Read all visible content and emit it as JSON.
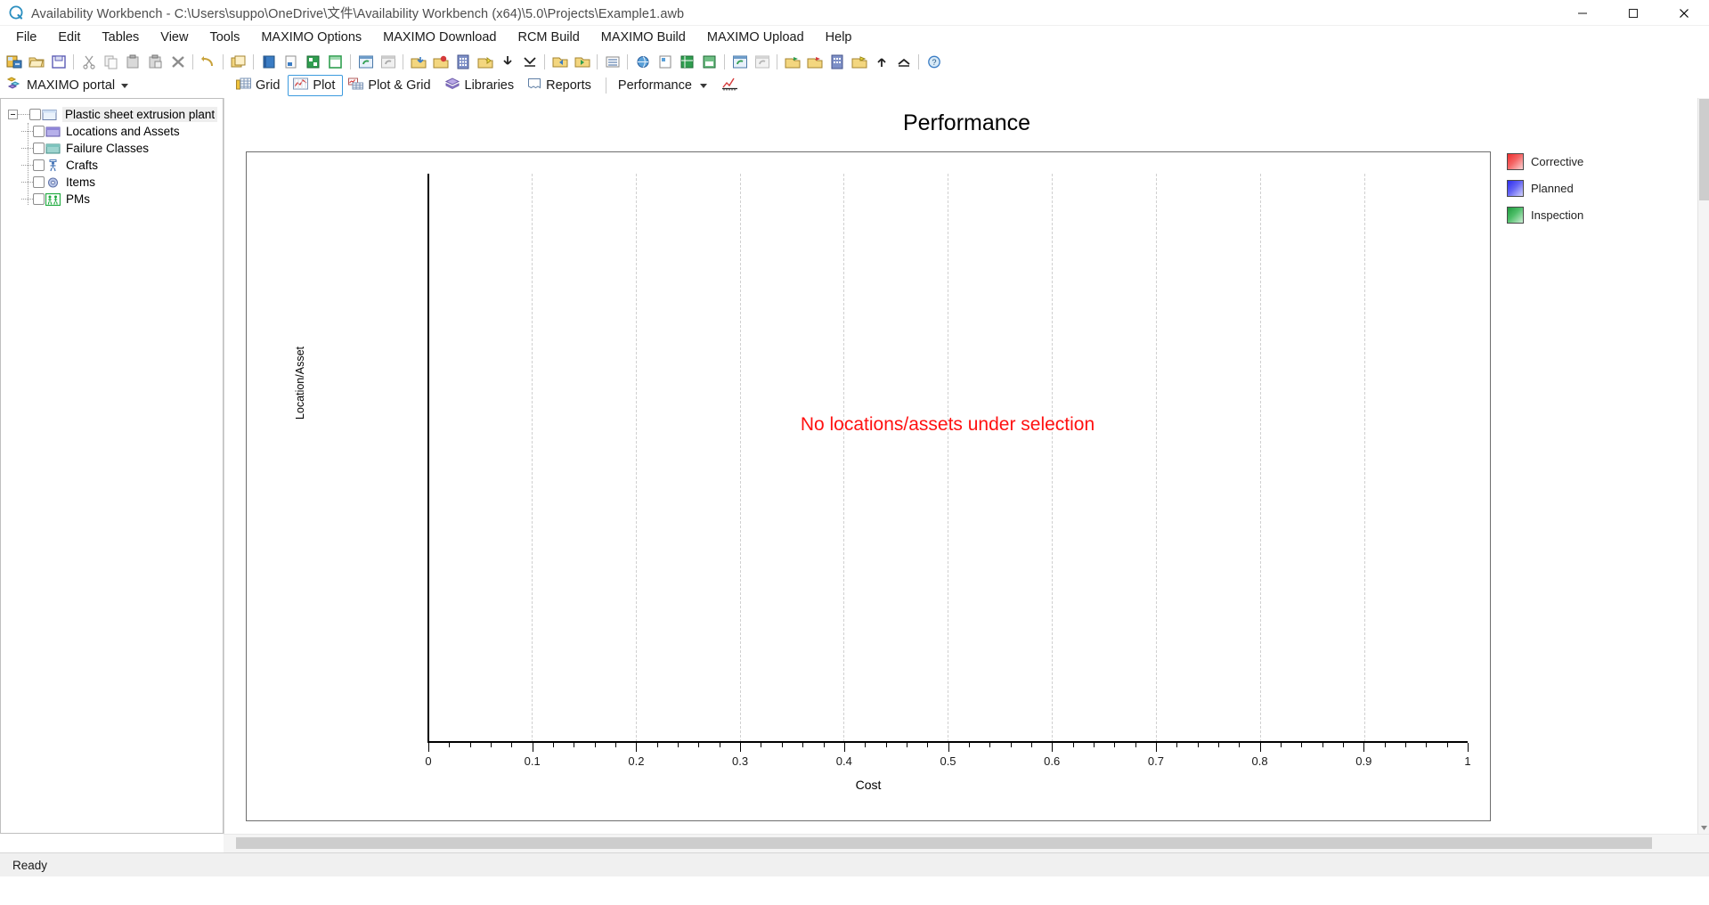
{
  "window": {
    "title": "Availability Workbench - C:\\Users\\suppo\\OneDrive\\文件\\Availability Workbench (x64)\\5.0\\Projects\\Example1.awb",
    "logo_icon": "app-logo-icon",
    "controls": [
      {
        "name": "minimize-button",
        "icon": "minimize-icon"
      },
      {
        "name": "maximize-button",
        "icon": "maximize-icon"
      },
      {
        "name": "close-button",
        "icon": "close-icon"
      }
    ]
  },
  "menubar": {
    "items": [
      {
        "label": "File"
      },
      {
        "label": "Edit"
      },
      {
        "label": "Tables"
      },
      {
        "label": "View"
      },
      {
        "label": "Tools"
      },
      {
        "label": "MAXIMO Options"
      },
      {
        "label": "MAXIMO Download"
      },
      {
        "label": "RCM Build"
      },
      {
        "label": "MAXIMO Build"
      },
      {
        "label": "MAXIMO Upload"
      },
      {
        "label": "Help"
      }
    ]
  },
  "toolbar": {
    "buttons": [
      {
        "name": "new-project-button",
        "icon": "new-project-icon"
      },
      {
        "name": "open-project-button",
        "icon": "open-folder-icon"
      },
      {
        "name": "save-project-button",
        "icon": "save-icon"
      },
      {
        "name": "cut-button",
        "icon": "scissors-icon"
      },
      {
        "name": "copy-button",
        "icon": "copy-icon"
      },
      {
        "name": "paste-button",
        "icon": "paste-icon"
      },
      {
        "name": "paste-special-button",
        "icon": "paste-special-icon"
      },
      {
        "name": "delete-button",
        "icon": "delete-x-icon"
      },
      {
        "name": "undo-button",
        "icon": "undo-arrow-icon"
      },
      {
        "name": "duplicate-button",
        "icon": "duplicate-folder-icon"
      },
      {
        "name": "book-button",
        "icon": "blue-book-icon"
      },
      {
        "name": "document-button",
        "icon": "document-icon"
      },
      {
        "name": "grid-green-button",
        "icon": "green-grid-icon"
      },
      {
        "name": "window-button",
        "icon": "green-window-icon"
      },
      {
        "name": "refresh-button",
        "icon": "refresh-window-icon"
      },
      {
        "name": "reload-button",
        "icon": "reload-window-icon"
      },
      {
        "name": "import-button",
        "icon": "import-arrow-icon"
      },
      {
        "name": "export-button",
        "icon": "export-arrow-icon"
      },
      {
        "name": "calculator-button",
        "icon": "calculator-icon"
      },
      {
        "name": "highlight-button",
        "icon": "highlight-icon"
      },
      {
        "name": "collapse-button",
        "icon": "down-arrow-icon"
      },
      {
        "name": "expand-button",
        "icon": "chevron-down-bar-icon"
      },
      {
        "name": "prev-button",
        "icon": "prev-record-icon"
      },
      {
        "name": "next-button",
        "icon": "next-record-icon"
      },
      {
        "name": "list-button",
        "icon": "list-icon"
      },
      {
        "name": "globe-button",
        "icon": "globe-icon"
      },
      {
        "name": "properties-button",
        "icon": "properties-icon"
      },
      {
        "name": "spreadsheet-button",
        "icon": "spreadsheet-icon"
      },
      {
        "name": "archive-button",
        "icon": "archive-icon"
      },
      {
        "name": "sync-button",
        "icon": "sync-icon"
      },
      {
        "name": "sync-disabled-button",
        "icon": "sync-disabled-icon"
      },
      {
        "name": "flag-green-button",
        "icon": "flag-green-icon"
      },
      {
        "name": "flag-red-button",
        "icon": "flag-red-icon"
      },
      {
        "name": "table-button",
        "icon": "table-icon"
      },
      {
        "name": "flag-yellow-button",
        "icon": "flag-yellow-icon"
      },
      {
        "name": "top-button",
        "icon": "arrow-up-bar-icon"
      },
      {
        "name": "bottom-button",
        "icon": "arrow-collapse-icon"
      },
      {
        "name": "help-button",
        "icon": "help-question-icon"
      }
    ]
  },
  "sidebar": {
    "portal_label": "MAXIMO portal",
    "portal_icon": "maximo-portal-icon",
    "tree": {
      "root": {
        "label": "Plastic sheet extrusion plant",
        "icon": "plant-folder-icon",
        "checked": false,
        "expanded": true
      },
      "children": [
        {
          "label": "Locations and Assets",
          "icon": "locations-assets-icon",
          "checked": false
        },
        {
          "label": "Failure Classes",
          "icon": "failure-classes-icon",
          "checked": false
        },
        {
          "label": "Crafts",
          "icon": "crafts-person-icon",
          "checked": false
        },
        {
          "label": "Items",
          "icon": "items-gear-icon",
          "checked": false
        },
        {
          "label": "PMs",
          "icon": "pms-people-icon",
          "checked": false
        }
      ]
    }
  },
  "tabs": {
    "items": [
      {
        "label": "Grid",
        "icon": "grid-icon",
        "active": false
      },
      {
        "label": "Plot",
        "icon": "plot-icon",
        "active": true
      },
      {
        "label": "Plot & Grid",
        "icon": "plot-grid-icon",
        "active": false
      },
      {
        "label": "Libraries",
        "icon": "libraries-book-icon",
        "active": false
      },
      {
        "label": "Reports",
        "icon": "reports-page-icon",
        "active": false
      }
    ],
    "dropdown": {
      "label": "Performance",
      "caret_icon": "chevron-down-icon",
      "chart_icon": "performance-chart-icon"
    }
  },
  "chart_data": {
    "type": "bar",
    "title": "Performance",
    "xlabel": "Cost",
    "ylabel": "Location/Asset",
    "xlim": [
      0,
      1
    ],
    "ylim": [
      0,
      1
    ],
    "x_ticks": [
      "0",
      "0.1",
      "0.2",
      "0.3",
      "0.4",
      "0.5",
      "0.6",
      "0.7",
      "0.8",
      "0.9",
      "1"
    ],
    "x_tick_values": [
      0,
      0.1,
      0.2,
      0.3,
      0.4,
      0.5,
      0.6,
      0.7,
      0.8,
      0.9,
      1
    ],
    "minor_tick_step": 0.02,
    "y_ticks": [],
    "grid": true,
    "grid_axis": "x",
    "legend_position": "right",
    "categories": [],
    "series": [
      {
        "name": "Corrective",
        "color": "#ef2d2d",
        "values": []
      },
      {
        "name": "Planned",
        "color": "#2d2def",
        "values": []
      },
      {
        "name": "Inspection",
        "color": "#1f9b3d",
        "values": []
      }
    ],
    "empty_message": "No locations/assets under selection"
  },
  "statusbar": {
    "text": "Ready"
  }
}
